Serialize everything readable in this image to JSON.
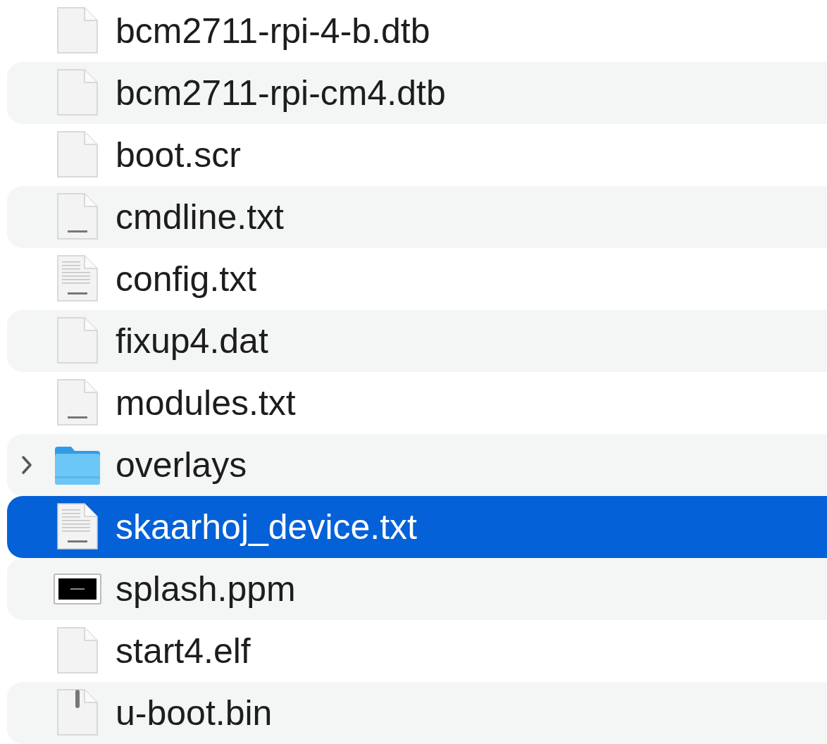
{
  "files": [
    {
      "name": "bcm2711-rpi-4-b.dtb",
      "kind": "blank",
      "selected": false
    },
    {
      "name": "bcm2711-rpi-cm4.dtb",
      "kind": "blank",
      "selected": false
    },
    {
      "name": "boot.scr",
      "kind": "blank",
      "selected": false
    },
    {
      "name": "cmdline.txt",
      "kind": "text",
      "selected": false
    },
    {
      "name": "config.txt",
      "kind": "text-lines",
      "selected": false
    },
    {
      "name": "fixup4.dat",
      "kind": "blank",
      "selected": false
    },
    {
      "name": "modules.txt",
      "kind": "text",
      "selected": false
    },
    {
      "name": "overlays",
      "kind": "folder",
      "expanded": false,
      "selected": false
    },
    {
      "name": "skaarhoj_device.txt",
      "kind": "text-lines",
      "selected": true
    },
    {
      "name": "splash.ppm",
      "kind": "image",
      "selected": false
    },
    {
      "name": "start4.elf",
      "kind": "blank",
      "selected": false
    },
    {
      "name": "u-boot.bin",
      "kind": "binary",
      "selected": false
    }
  ]
}
